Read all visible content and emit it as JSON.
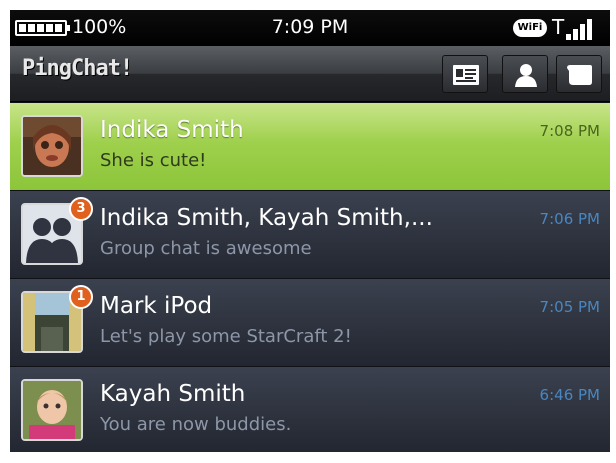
{
  "status": {
    "battery": "100%",
    "time": "7:09 PM",
    "wifi_label": "WiFi"
  },
  "app": {
    "title": "PingChat!",
    "buttons": [
      "contact-card-icon",
      "person-icon",
      "chat-bubble-icon"
    ]
  },
  "chats": [
    {
      "name": "Indika Smith",
      "message": "She is cute!",
      "time": "7:08 PM",
      "unread": "",
      "selected": true,
      "avatar": "photo"
    },
    {
      "name": "Indika Smith, Kayah Smith,...",
      "message": "Group chat is awesome",
      "time": "7:06 PM",
      "unread": "3",
      "selected": false,
      "avatar": "group-icon"
    },
    {
      "name": "Mark iPod",
      "message": "Let's play some StarCraft 2!",
      "time": "7:05 PM",
      "unread": "1",
      "selected": false,
      "avatar": "photo"
    },
    {
      "name": "Kayah Smith",
      "message": "You are now buddies.",
      "time": "6:46 PM",
      "unread": "",
      "selected": false,
      "avatar": "photo"
    }
  ],
  "colors": {
    "selected_row": "#9fd04d",
    "row_bg": "#2c313d",
    "time_text": "#4a86c0",
    "badge": "#e0601e"
  }
}
